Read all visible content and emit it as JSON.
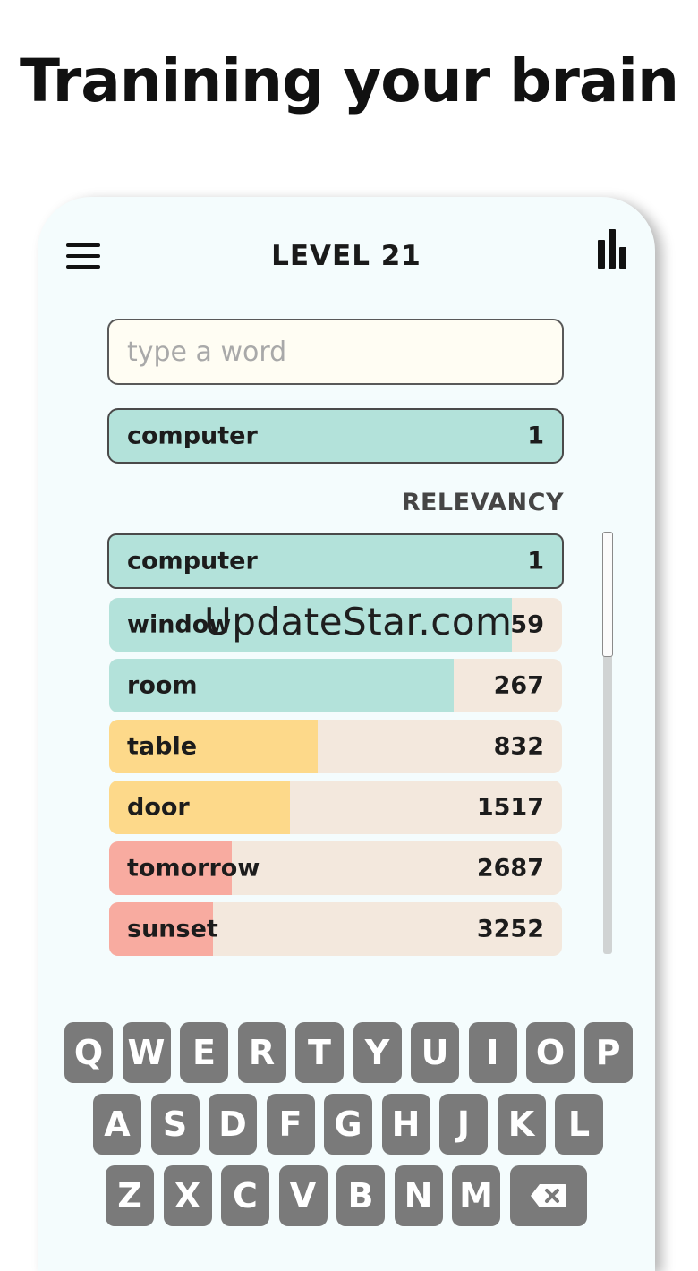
{
  "headline": "Tranining your brain",
  "header": {
    "level_title": "LEVEL 21"
  },
  "input": {
    "placeholder": "type a word",
    "value": ""
  },
  "current_guess": {
    "word": "computer",
    "rank": "1"
  },
  "relevancy_label": "RELEVANCY",
  "watermark": "UpdateStar.com",
  "colors": {
    "teal": "#b3e2da",
    "yellow": "#fdd98a",
    "red": "#f8aba0",
    "track": "#f3e8dd"
  },
  "guesses": [
    {
      "word": "computer",
      "rank": "1",
      "fill": 1.0,
      "color": "teal"
    },
    {
      "word": "window",
      "rank": "59",
      "fill": 0.89,
      "color": "teal"
    },
    {
      "word": "room",
      "rank": "267",
      "fill": 0.76,
      "color": "teal"
    },
    {
      "word": "table",
      "rank": "832",
      "fill": 0.46,
      "color": "yellow"
    },
    {
      "word": "door",
      "rank": "1517",
      "fill": 0.4,
      "color": "yellow"
    },
    {
      "word": "tomorrow",
      "rank": "2687",
      "fill": 0.27,
      "color": "red"
    },
    {
      "word": "sunset",
      "rank": "3252",
      "fill": 0.23,
      "color": "red"
    }
  ],
  "keyboard": {
    "row1": [
      "Q",
      "W",
      "E",
      "R",
      "T",
      "Y",
      "U",
      "I",
      "O",
      "P"
    ],
    "row2": [
      "A",
      "S",
      "D",
      "F",
      "G",
      "H",
      "J",
      "K",
      "L"
    ],
    "row3": [
      "Z",
      "X",
      "C",
      "V",
      "B",
      "N",
      "M"
    ],
    "backspace_icon": "backspace-icon"
  }
}
